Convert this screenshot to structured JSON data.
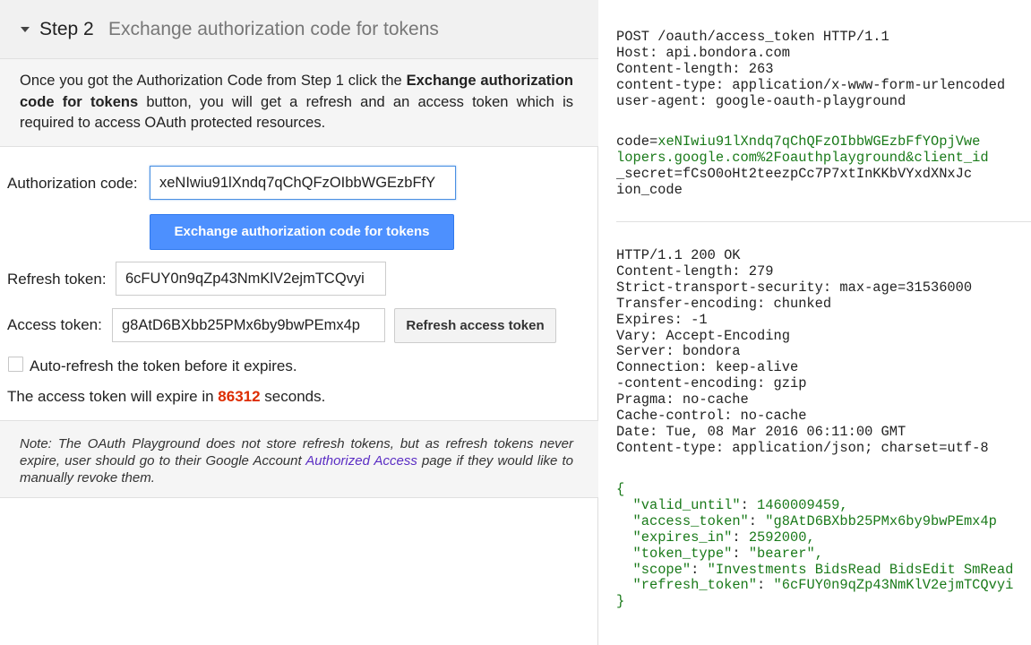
{
  "step": {
    "number": "Step 2",
    "title": "Exchange authorization code for tokens"
  },
  "intro": {
    "before": "Once you got the Authorization Code from Step 1 click the ",
    "bold": "Exchange authorization code for tokens",
    "after": " button, you will get a refresh and an access token which is required to access OAuth protected resources."
  },
  "auth_code": {
    "label": "Authorization code:",
    "value": "xeNIwiu91lXndq7qChQFzOIbbWGEzbFfY"
  },
  "exchange_button": "Exchange authorization code for tokens",
  "refresh_token": {
    "label": "Refresh token:",
    "value": "6cFUY0n9qZp43NmKlV2ejmTCQvyi"
  },
  "access_token": {
    "label": "Access token:",
    "value": "g8AtD6BXbb25PMx6by9bwPEmx4p"
  },
  "refresh_button": "Refresh access token",
  "auto_refresh": {
    "label": "Auto-refresh the token before it expires.",
    "checked": false
  },
  "expire": {
    "before": "The access token will expire in ",
    "count": "86312",
    "after": " seconds."
  },
  "note": {
    "before": "Note: The OAuth Playground does not store refresh tokens, but as refresh tokens never expire, user should go to their Google Account ",
    "link": "Authorized Access",
    "after": " page if they would like to manually revoke them."
  },
  "request": {
    "lines": [
      "POST /oauth/access_token HTTP/1.1",
      "Host: api.bondora.com",
      "Content-length: 263",
      "content-type: application/x-www-form-urlencoded",
      "user-agent: google-oauth-playground"
    ],
    "body": [
      {
        "k": "code",
        "v": "xeNIwiu91lXndq7qChQFzOIbbWGEzbFfYOpjVwe"
      },
      {
        "raw": "lopers.google.com%2Foauthplayground&client_id"
      },
      {
        "raw": "_secret=fCsO0oHt2teezpCc7P7xtInKKbVYxdXNxJc"
      },
      {
        "raw": "ion_code"
      }
    ]
  },
  "response": {
    "lines": [
      "HTTP/1.1 200 OK",
      "Content-length: 279",
      "Strict-transport-security: max-age=31536000",
      "Transfer-encoding: chunked",
      "Expires: -1",
      "Vary: Accept-Encoding",
      "Server: bondora",
      "Connection: keep-alive",
      "-content-encoding: gzip",
      "Pragma: no-cache",
      "Cache-control: no-cache",
      "Date: Tue, 08 Mar 2016 06:11:00 GMT",
      "Content-type: application/json; charset=utf-8"
    ],
    "json_open": "{",
    "json": [
      {
        "k": "\"valid_until\"",
        "v": "1460009459,"
      },
      {
        "k": "\"access_token\"",
        "v": "\"g8AtD6BXbb25PMx6by9bwPEmx4p"
      },
      {
        "k": "\"expires_in\"",
        "v": "2592000,"
      },
      {
        "k": "\"token_type\"",
        "v": "\"bearer\","
      },
      {
        "k": "\"scope\"",
        "v": "\"Investments BidsRead BidsEdit SmRead"
      },
      {
        "k": "\"refresh_token\"",
        "v": "\"6cFUY0n9qZp43NmKlV2ejmTCQvyi"
      }
    ],
    "json_close": "}"
  }
}
